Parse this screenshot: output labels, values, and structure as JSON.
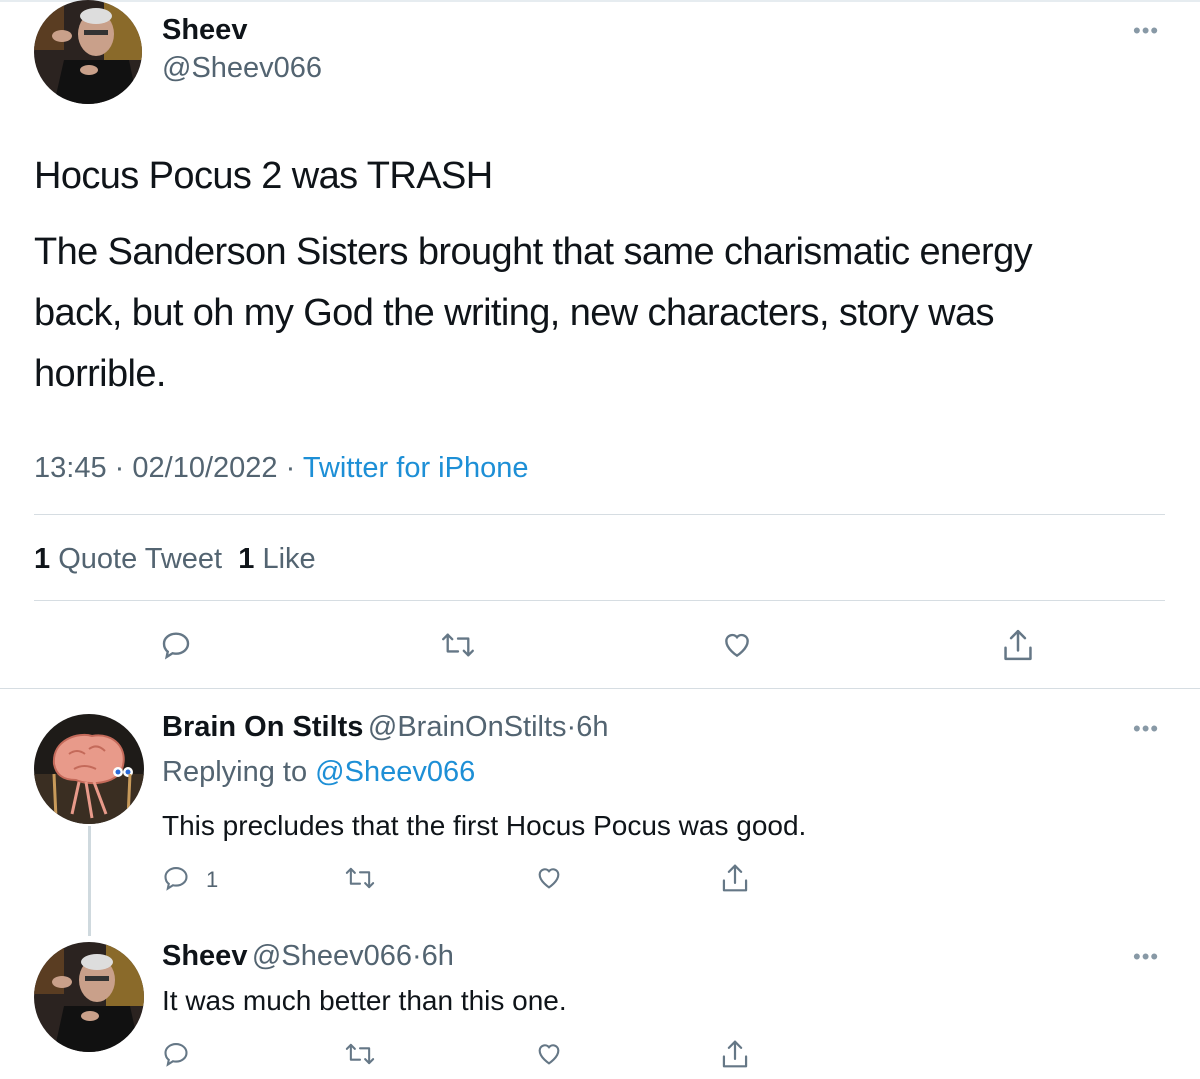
{
  "main_tweet": {
    "author_name": "Sheev",
    "author_handle": "@Sheev066",
    "line1": "Hocus Pocus 2 was TRASH",
    "line2": "The Sanderson Sisters brought that same charismatic energy",
    "line3": "back, but oh my God the writing, new characters, story was",
    "line4": "horrible.",
    "time": "13:45",
    "date": "02/10/2022",
    "separator": "·",
    "source": "Twitter for iPhone",
    "quote_count": "1",
    "quote_label": "Quote Tweet",
    "like_count": "1",
    "like_label": "Like",
    "more": "•••"
  },
  "replies": [
    {
      "author_name": "Brain On Stilts",
      "author_handle": "@BrainOnStilts",
      "age": "6h",
      "replying_label": "Replying to",
      "replying_to": "@Sheev066",
      "text": "This precludes that the first Hocus Pocus was good.",
      "reply_count": "1",
      "more": "•••"
    },
    {
      "author_name": "Sheev",
      "author_handle": "@Sheev066",
      "age": "6h",
      "text": "It was much better than this one.",
      "more": "•••"
    }
  ],
  "icons": [
    "reply-icon",
    "retweet-icon",
    "like-icon",
    "share-icon"
  ],
  "colors": {
    "link": "#1d8fd6",
    "secondary": "#536471",
    "divider": "#d6dde2",
    "icon": "#657786"
  }
}
